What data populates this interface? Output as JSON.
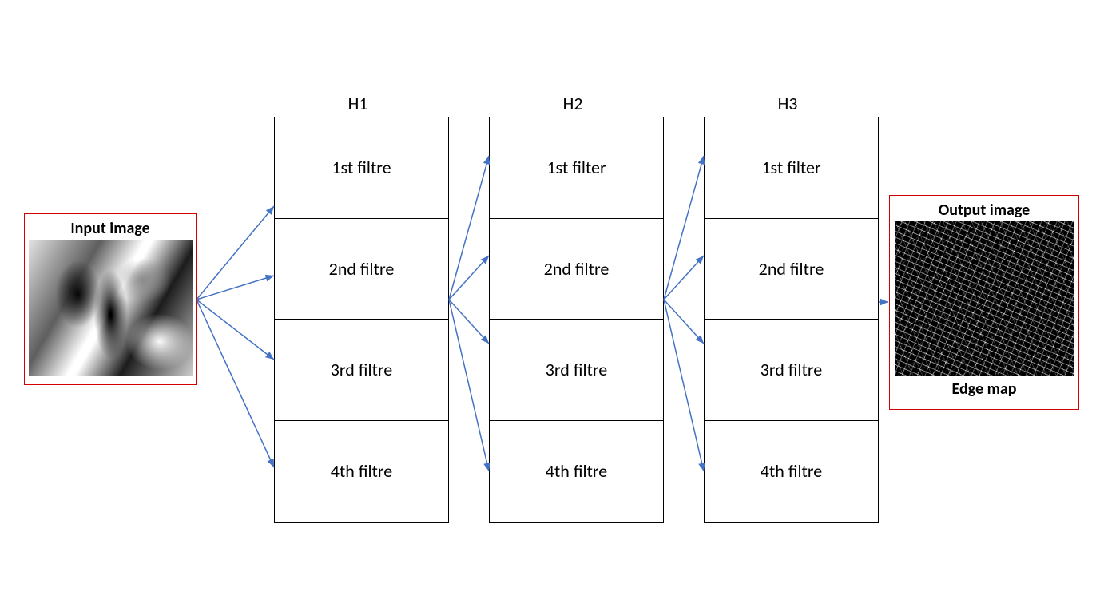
{
  "input": {
    "title": "Input image"
  },
  "output": {
    "title": "Output image",
    "subtitle": "Edge map"
  },
  "layers": {
    "h1": {
      "label": "H1",
      "filters": [
        "1st filtre",
        "2nd filtre",
        "3rd filtre",
        "4th filtre"
      ]
    },
    "h2": {
      "label": "H2",
      "filters": [
        "1st filter",
        "2nd filtre",
        "3rd filtre",
        "4th filtre"
      ]
    },
    "h3": {
      "label": "H3",
      "filters": [
        "1st filter",
        "2nd filtre",
        "3rd filtre",
        "4th filtre"
      ]
    }
  }
}
